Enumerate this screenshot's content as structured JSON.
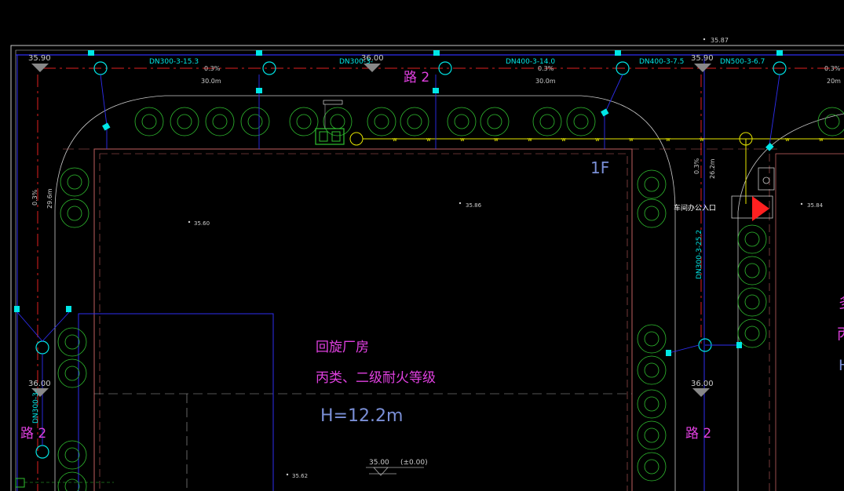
{
  "colors": {
    "background": "#000000",
    "road_edge": "#c9c9c9",
    "pipe_blue": "#2e2ef0",
    "pipe_red": "#e02020",
    "dim_cyan": "#00e6e6",
    "magenta": "#e040e0",
    "tree_green": "#30c030",
    "building_red": "#c06060",
    "yellow_line": "#e6e600",
    "white_gray": "#aaaaaa",
    "steel_blue": "#7a8fd6"
  },
  "elevations": {
    "top_small": "35.87",
    "tl": "35.90",
    "tm": "36.00",
    "tr": "35.90",
    "ml": "36.00",
    "mr": "36.00",
    "c1": "35.60",
    "c2": "35.86",
    "c3": "35.84",
    "c4": "35.62",
    "bottom": "35.00",
    "bottom_paren": "(±0.00)"
  },
  "pipes": {
    "p1": "DN300-3-15.3",
    "p2": "DN300-3-",
    "p3": "DN400-3-14.0",
    "p4": "DN400-3-7.5",
    "p5": "DN500-3-6.7",
    "p6": "DN300-3-25.2",
    "p7": "DN300-3-",
    "g1": "0.3%",
    "g2": "0.3%",
    "g3": "0.3%",
    "g4": "0.3%",
    "g5": "0.3%",
    "g6": "0.3%",
    "d1": "30.0m",
    "d2": "30.0m",
    "d3": "20m",
    "d4": "26.2m",
    "d5": "29.6m"
  },
  "road": {
    "top": "路 2",
    "left": "路 2",
    "right": "路 2"
  },
  "building": {
    "floor": "1F",
    "name": "回旋厂房",
    "fire": "丙类、二级耐火等级",
    "height": "H=12.2m"
  },
  "entrance": "车间办公入口",
  "right_partial_1": "多",
  "right_partial_2": "丙",
  "right_partial_3": "H"
}
